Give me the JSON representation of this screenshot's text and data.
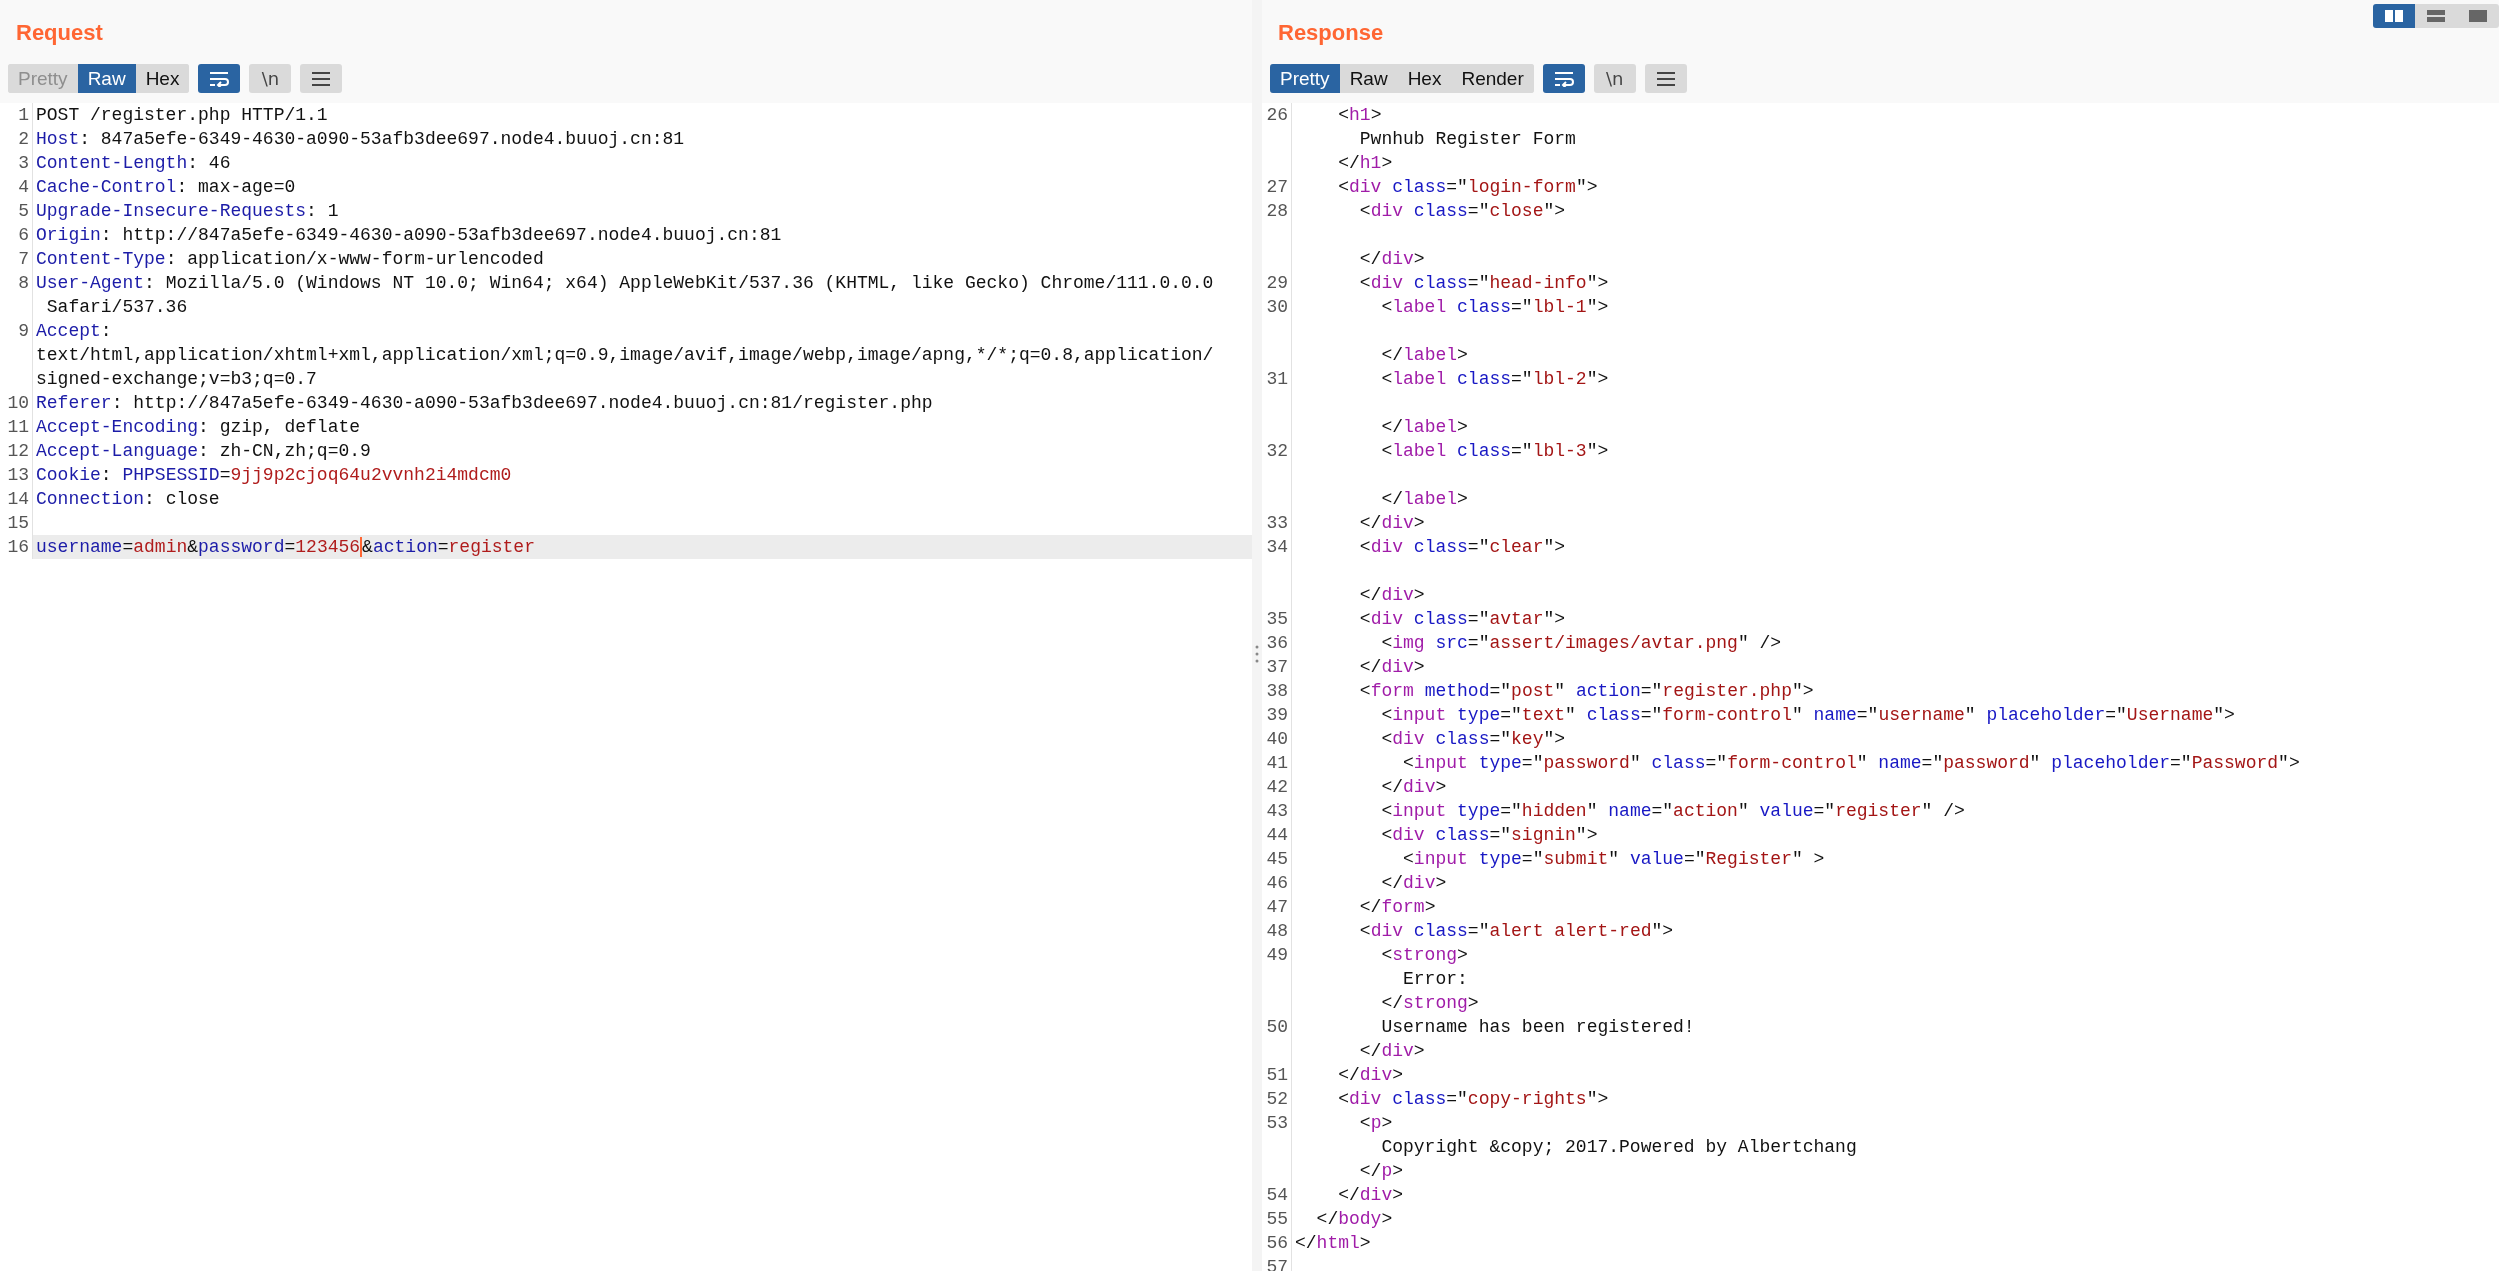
{
  "layout_modes": [
    {
      "kind": "columns",
      "selected": true
    },
    {
      "kind": "rows",
      "selected": false
    },
    {
      "kind": "single",
      "selected": false
    }
  ],
  "request": {
    "title": "Request",
    "tabs": [
      {
        "label": "Pretty",
        "selected": false,
        "disabled": true
      },
      {
        "label": "Raw",
        "selected": true,
        "disabled": false
      },
      {
        "label": "Hex",
        "selected": false,
        "disabled": false
      }
    ],
    "tools": [
      {
        "kind": "wrap",
        "active": true
      },
      {
        "kind": "newline",
        "label": "\\n",
        "active": false
      },
      {
        "kind": "menu",
        "active": false
      }
    ],
    "rows": [
      {
        "number": "1",
        "highlighted": false,
        "tokens": [
          {
            "kind": "plain",
            "text": "POST /register.php HTTP/1.1"
          }
        ]
      },
      {
        "number": "2",
        "highlighted": false,
        "tokens": [
          {
            "kind": "header",
            "text": "Host"
          },
          {
            "kind": "plain",
            "text": ": 847a5efe-6349-4630-a090-53afb3dee697.node4.buuoj.cn:81"
          }
        ]
      },
      {
        "number": "3",
        "highlighted": false,
        "tokens": [
          {
            "kind": "header",
            "text": "Content-Length"
          },
          {
            "kind": "plain",
            "text": ": 46"
          }
        ]
      },
      {
        "number": "4",
        "highlighted": false,
        "tokens": [
          {
            "kind": "header",
            "text": "Cache-Control"
          },
          {
            "kind": "plain",
            "text": ": max-age=0"
          }
        ]
      },
      {
        "number": "5",
        "highlighted": false,
        "tokens": [
          {
            "kind": "header",
            "text": "Upgrade-Insecure-Requests"
          },
          {
            "kind": "plain",
            "text": ": 1"
          }
        ]
      },
      {
        "number": "6",
        "highlighted": false,
        "tokens": [
          {
            "kind": "header",
            "text": "Origin"
          },
          {
            "kind": "plain",
            "text": ": http://847a5efe-6349-4630-a090-53afb3dee697.node4.buuoj.cn:81"
          }
        ]
      },
      {
        "number": "7",
        "highlighted": false,
        "tokens": [
          {
            "kind": "header",
            "text": "Content-Type"
          },
          {
            "kind": "plain",
            "text": ": application/x-www-form-urlencoded"
          }
        ]
      },
      {
        "number": "8",
        "highlighted": false,
        "tokens": [
          {
            "kind": "header",
            "text": "User-Agent"
          },
          {
            "kind": "plain",
            "text": ": Mozilla/5.0 (Windows NT 10.0; Win64; x64) AppleWebKit/537.36 (KHTML, like Gecko) Chrome/111.0.0.0"
          }
        ]
      },
      {
        "highlighted": false,
        "tokens": [
          {
            "kind": "plain",
            "text": " Safari/537.36"
          }
        ]
      },
      {
        "number": "9",
        "highlighted": false,
        "tokens": [
          {
            "kind": "header",
            "text": "Accept"
          },
          {
            "kind": "plain",
            "text": ":"
          }
        ]
      },
      {
        "highlighted": false,
        "tokens": [
          {
            "kind": "plain",
            "text": "text/html,application/xhtml+xml,application/xml;q=0.9,image/avif,image/webp,image/apng,*/*;q=0.8,application/"
          }
        ]
      },
      {
        "highlighted": false,
        "tokens": [
          {
            "kind": "plain",
            "text": "signed-exchange;v=b3;q=0.7"
          }
        ]
      },
      {
        "number": "10",
        "highlighted": false,
        "tokens": [
          {
            "kind": "header",
            "text": "Referer"
          },
          {
            "kind": "plain",
            "text": ": http://847a5efe-6349-4630-a090-53afb3dee697.node4.buuoj.cn:81/register.php"
          }
        ]
      },
      {
        "number": "11",
        "highlighted": false,
        "tokens": [
          {
            "kind": "header",
            "text": "Accept-Encoding"
          },
          {
            "kind": "plain",
            "text": ": gzip, deflate"
          }
        ]
      },
      {
        "number": "12",
        "highlighted": false,
        "tokens": [
          {
            "kind": "header",
            "text": "Accept-Language"
          },
          {
            "kind": "plain",
            "text": ": zh-CN,zh;q=0.9"
          }
        ]
      },
      {
        "number": "13",
        "highlighted": false,
        "tokens": [
          {
            "kind": "header",
            "text": "Cookie"
          },
          {
            "kind": "plain",
            "text": ": "
          },
          {
            "kind": "header",
            "text": "PHPSESSID"
          },
          {
            "kind": "plain",
            "text": "="
          },
          {
            "kind": "value",
            "text": "9jj9p2cjoq64u2vvnh2i4mdcm0"
          }
        ]
      },
      {
        "number": "14",
        "highlighted": false,
        "tokens": [
          {
            "kind": "header",
            "text": "Connection"
          },
          {
            "kind": "plain",
            "text": ": close"
          }
        ]
      },
      {
        "number": "15",
        "highlighted": false
      },
      {
        "number": "16",
        "highlighted": true,
        "tokens": [
          {
            "kind": "header",
            "text": "username"
          },
          {
            "kind": "plain",
            "text": "="
          },
          {
            "kind": "value",
            "text": "admin"
          },
          {
            "kind": "plain",
            "text": "&"
          },
          {
            "kind": "header",
            "text": "password"
          },
          {
            "kind": "plain",
            "text": "="
          },
          {
            "kind": "value",
            "text": "123456",
            "caret": true
          },
          {
            "kind": "plain",
            "text": "&"
          },
          {
            "kind": "header",
            "text": "action"
          },
          {
            "kind": "plain",
            "text": "="
          },
          {
            "kind": "value",
            "text": "register"
          }
        ]
      }
    ]
  },
  "response": {
    "title": "Response",
    "tabs": [
      {
        "label": "Pretty",
        "selected": true,
        "disabled": false
      },
      {
        "label": "Raw",
        "selected": false,
        "disabled": false
      },
      {
        "label": "Hex",
        "selected": false,
        "disabled": false
      },
      {
        "label": "Render",
        "selected": false,
        "disabled": false
      }
    ],
    "tools": [
      {
        "kind": "wrap",
        "active": true
      },
      {
        "kind": "newline",
        "label": "\\n",
        "active": false
      },
      {
        "kind": "menu",
        "active": false
      }
    ],
    "rows": [
      {
        "number": "26",
        "tokens": [
          {
            "kind": "plain",
            "text": "    <"
          },
          {
            "kind": "tag",
            "text": "h1"
          },
          {
            "kind": "plain",
            "text": ">"
          }
        ]
      },
      {
        "tokens": [
          {
            "kind": "plain",
            "text": "      Pwnhub Register Form"
          }
        ]
      },
      {
        "tokens": [
          {
            "kind": "plain",
            "text": "    </"
          },
          {
            "kind": "tag",
            "text": "h1"
          },
          {
            "kind": "plain",
            "text": ">"
          }
        ]
      },
      {
        "number": "27",
        "tokens": [
          {
            "kind": "plain",
            "text": "    <"
          },
          {
            "kind": "tag",
            "text": "div"
          },
          {
            "kind": "attr",
            "text": " class"
          },
          {
            "kind": "plain",
            "text": "=\""
          },
          {
            "kind": "string",
            "text": "login-form"
          },
          {
            "kind": "plain",
            "text": "\">"
          }
        ]
      },
      {
        "number": "28",
        "tokens": [
          {
            "kind": "plain",
            "text": "      <"
          },
          {
            "kind": "tag",
            "text": "div"
          },
          {
            "kind": "attr",
            "text": " class"
          },
          {
            "kind": "plain",
            "text": "=\""
          },
          {
            "kind": "string",
            "text": "close"
          },
          {
            "kind": "plain",
            "text": "\">"
          }
        ]
      },
      {},
      {
        "tokens": [
          {
            "kind": "plain",
            "text": "      </"
          },
          {
            "kind": "tag",
            "text": "div"
          },
          {
            "kind": "plain",
            "text": ">"
          }
        ]
      },
      {
        "number": "29",
        "tokens": [
          {
            "kind": "plain",
            "text": "      <"
          },
          {
            "kind": "tag",
            "text": "div"
          },
          {
            "kind": "attr",
            "text": " class"
          },
          {
            "kind": "plain",
            "text": "=\""
          },
          {
            "kind": "string",
            "text": "head-info"
          },
          {
            "kind": "plain",
            "text": "\">"
          }
        ]
      },
      {
        "number": "30",
        "tokens": [
          {
            "kind": "plain",
            "text": "        <"
          },
          {
            "kind": "tag",
            "text": "label"
          },
          {
            "kind": "attr",
            "text": " class"
          },
          {
            "kind": "plain",
            "text": "=\""
          },
          {
            "kind": "string",
            "text": "lbl-1"
          },
          {
            "kind": "plain",
            "text": "\">"
          }
        ]
      },
      {},
      {
        "tokens": [
          {
            "kind": "plain",
            "text": "        </"
          },
          {
            "kind": "tag",
            "text": "label"
          },
          {
            "kind": "plain",
            "text": ">"
          }
        ]
      },
      {
        "number": "31",
        "tokens": [
          {
            "kind": "plain",
            "text": "        <"
          },
          {
            "kind": "tag",
            "text": "label"
          },
          {
            "kind": "attr",
            "text": " class"
          },
          {
            "kind": "plain",
            "text": "=\""
          },
          {
            "kind": "string",
            "text": "lbl-2"
          },
          {
            "kind": "plain",
            "text": "\">"
          }
        ]
      },
      {},
      {
        "tokens": [
          {
            "kind": "plain",
            "text": "        </"
          },
          {
            "kind": "tag",
            "text": "label"
          },
          {
            "kind": "plain",
            "text": ">"
          }
        ]
      },
      {
        "number": "32",
        "tokens": [
          {
            "kind": "plain",
            "text": "        <"
          },
          {
            "kind": "tag",
            "text": "label"
          },
          {
            "kind": "attr",
            "text": " class"
          },
          {
            "kind": "plain",
            "text": "=\""
          },
          {
            "kind": "string",
            "text": "lbl-3"
          },
          {
            "kind": "plain",
            "text": "\">"
          }
        ]
      },
      {},
      {
        "tokens": [
          {
            "kind": "plain",
            "text": "        </"
          },
          {
            "kind": "tag",
            "text": "label"
          },
          {
            "kind": "plain",
            "text": ">"
          }
        ]
      },
      {
        "number": "33",
        "tokens": [
          {
            "kind": "plain",
            "text": "      </"
          },
          {
            "kind": "tag",
            "text": "div"
          },
          {
            "kind": "plain",
            "text": ">"
          }
        ]
      },
      {
        "number": "34",
        "tokens": [
          {
            "kind": "plain",
            "text": "      <"
          },
          {
            "kind": "tag",
            "text": "div"
          },
          {
            "kind": "attr",
            "text": " class"
          },
          {
            "kind": "plain",
            "text": "=\""
          },
          {
            "kind": "string",
            "text": "clear"
          },
          {
            "kind": "plain",
            "text": "\">"
          }
        ]
      },
      {},
      {
        "tokens": [
          {
            "kind": "plain",
            "text": "      </"
          },
          {
            "kind": "tag",
            "text": "div"
          },
          {
            "kind": "plain",
            "text": ">"
          }
        ]
      },
      {
        "number": "35",
        "tokens": [
          {
            "kind": "plain",
            "text": "      <"
          },
          {
            "kind": "tag",
            "text": "div"
          },
          {
            "kind": "attr",
            "text": " class"
          },
          {
            "kind": "plain",
            "text": "=\""
          },
          {
            "kind": "string",
            "text": "avtar"
          },
          {
            "kind": "plain",
            "text": "\">"
          }
        ]
      },
      {
        "number": "36",
        "tokens": [
          {
            "kind": "plain",
            "text": "        <"
          },
          {
            "kind": "tag",
            "text": "img"
          },
          {
            "kind": "attr",
            "text": " src"
          },
          {
            "kind": "plain",
            "text": "=\""
          },
          {
            "kind": "string",
            "text": "assert/images/avtar.png"
          },
          {
            "kind": "plain",
            "text": "\" />"
          }
        ]
      },
      {
        "number": "37",
        "tokens": [
          {
            "kind": "plain",
            "text": "      </"
          },
          {
            "kind": "tag",
            "text": "div"
          },
          {
            "kind": "plain",
            "text": ">"
          }
        ]
      },
      {
        "number": "38",
        "tokens": [
          {
            "kind": "plain",
            "text": "      <"
          },
          {
            "kind": "tag",
            "text": "form"
          },
          {
            "kind": "attr",
            "text": " method"
          },
          {
            "kind": "plain",
            "text": "=\""
          },
          {
            "kind": "string",
            "text": "post"
          },
          {
            "kind": "plain",
            "text": "\" "
          },
          {
            "kind": "attr",
            "text": "action"
          },
          {
            "kind": "plain",
            "text": "=\""
          },
          {
            "kind": "string",
            "text": "register.php"
          },
          {
            "kind": "plain",
            "text": "\">"
          }
        ]
      },
      {
        "number": "39",
        "tokens": [
          {
            "kind": "plain",
            "text": "        <"
          },
          {
            "kind": "tag",
            "text": "input"
          },
          {
            "kind": "attr",
            "text": " type"
          },
          {
            "kind": "plain",
            "text": "=\""
          },
          {
            "kind": "string",
            "text": "text"
          },
          {
            "kind": "plain",
            "text": "\" "
          },
          {
            "kind": "attr",
            "text": "class"
          },
          {
            "kind": "plain",
            "text": "=\""
          },
          {
            "kind": "string",
            "text": "form-control"
          },
          {
            "kind": "plain",
            "text": "\" "
          },
          {
            "kind": "attr",
            "text": "name"
          },
          {
            "kind": "plain",
            "text": "=\""
          },
          {
            "kind": "string",
            "text": "username"
          },
          {
            "kind": "plain",
            "text": "\" "
          },
          {
            "kind": "attr",
            "text": "placeholder"
          },
          {
            "kind": "plain",
            "text": "=\""
          },
          {
            "kind": "string",
            "text": "Username"
          },
          {
            "kind": "plain",
            "text": "\">"
          }
        ]
      },
      {
        "number": "40",
        "tokens": [
          {
            "kind": "plain",
            "text": "        <"
          },
          {
            "kind": "tag",
            "text": "div"
          },
          {
            "kind": "attr",
            "text": " class"
          },
          {
            "kind": "plain",
            "text": "=\""
          },
          {
            "kind": "string",
            "text": "key"
          },
          {
            "kind": "plain",
            "text": "\">"
          }
        ]
      },
      {
        "number": "41",
        "tokens": [
          {
            "kind": "plain",
            "text": "          <"
          },
          {
            "kind": "tag",
            "text": "input"
          },
          {
            "kind": "attr",
            "text": " type"
          },
          {
            "kind": "plain",
            "text": "=\""
          },
          {
            "kind": "string",
            "text": "password"
          },
          {
            "kind": "plain",
            "text": "\" "
          },
          {
            "kind": "attr",
            "text": "class"
          },
          {
            "kind": "plain",
            "text": "=\""
          },
          {
            "kind": "string",
            "text": "form-control"
          },
          {
            "kind": "plain",
            "text": "\" "
          },
          {
            "kind": "attr",
            "text": "name"
          },
          {
            "kind": "plain",
            "text": "=\""
          },
          {
            "kind": "string",
            "text": "password"
          },
          {
            "kind": "plain",
            "text": "\" "
          },
          {
            "kind": "attr",
            "text": "placeholder"
          },
          {
            "kind": "plain",
            "text": "=\""
          },
          {
            "kind": "string",
            "text": "Password"
          },
          {
            "kind": "plain",
            "text": "\">"
          }
        ]
      },
      {
        "number": "42",
        "tokens": [
          {
            "kind": "plain",
            "text": "        </"
          },
          {
            "kind": "tag",
            "text": "div"
          },
          {
            "kind": "plain",
            "text": ">"
          }
        ]
      },
      {
        "number": "43",
        "tokens": [
          {
            "kind": "plain",
            "text": "        <"
          },
          {
            "kind": "tag",
            "text": "input"
          },
          {
            "kind": "attr",
            "text": " type"
          },
          {
            "kind": "plain",
            "text": "=\""
          },
          {
            "kind": "string",
            "text": "hidden"
          },
          {
            "kind": "plain",
            "text": "\" "
          },
          {
            "kind": "attr",
            "text": "name"
          },
          {
            "kind": "plain",
            "text": "=\""
          },
          {
            "kind": "string",
            "text": "action"
          },
          {
            "kind": "plain",
            "text": "\" "
          },
          {
            "kind": "attr",
            "text": "value"
          },
          {
            "kind": "plain",
            "text": "=\""
          },
          {
            "kind": "string",
            "text": "register"
          },
          {
            "kind": "plain",
            "text": "\" />"
          }
        ]
      },
      {
        "number": "44",
        "tokens": [
          {
            "kind": "plain",
            "text": "        <"
          },
          {
            "kind": "tag",
            "text": "div"
          },
          {
            "kind": "attr",
            "text": " class"
          },
          {
            "kind": "plain",
            "text": "=\""
          },
          {
            "kind": "string",
            "text": "signin"
          },
          {
            "kind": "plain",
            "text": "\">"
          }
        ]
      },
      {
        "number": "45",
        "tokens": [
          {
            "kind": "plain",
            "text": "          <"
          },
          {
            "kind": "tag",
            "text": "input"
          },
          {
            "kind": "attr",
            "text": " type"
          },
          {
            "kind": "plain",
            "text": "=\""
          },
          {
            "kind": "string",
            "text": "submit"
          },
          {
            "kind": "plain",
            "text": "\" "
          },
          {
            "kind": "attr",
            "text": "value"
          },
          {
            "kind": "plain",
            "text": "=\""
          },
          {
            "kind": "string",
            "text": "Register"
          },
          {
            "kind": "plain",
            "text": "\" >"
          }
        ]
      },
      {
        "number": "46",
        "tokens": [
          {
            "kind": "plain",
            "text": "        </"
          },
          {
            "kind": "tag",
            "text": "div"
          },
          {
            "kind": "plain",
            "text": ">"
          }
        ]
      },
      {
        "number": "47",
        "tokens": [
          {
            "kind": "plain",
            "text": "      </"
          },
          {
            "kind": "tag",
            "text": "form"
          },
          {
            "kind": "plain",
            "text": ">"
          }
        ]
      },
      {
        "number": "48",
        "tokens": [
          {
            "kind": "plain",
            "text": "      <"
          },
          {
            "kind": "tag",
            "text": "div"
          },
          {
            "kind": "attr",
            "text": " class"
          },
          {
            "kind": "plain",
            "text": "=\""
          },
          {
            "kind": "string",
            "text": "alert alert-red"
          },
          {
            "kind": "plain",
            "text": "\">"
          }
        ]
      },
      {
        "number": "49",
        "tokens": [
          {
            "kind": "plain",
            "text": "        <"
          },
          {
            "kind": "tag",
            "text": "strong"
          },
          {
            "kind": "plain",
            "text": ">"
          }
        ]
      },
      {
        "tokens": [
          {
            "kind": "plain",
            "text": "          Error:"
          }
        ]
      },
      {
        "tokens": [
          {
            "kind": "plain",
            "text": "        </"
          },
          {
            "kind": "tag",
            "text": "strong"
          },
          {
            "kind": "plain",
            "text": ">"
          }
        ]
      },
      {
        "number": "50",
        "tokens": [
          {
            "kind": "plain",
            "text": "        Username has been registered!"
          }
        ]
      },
      {
        "tokens": [
          {
            "kind": "plain",
            "text": "      </"
          },
          {
            "kind": "tag",
            "text": "div"
          },
          {
            "kind": "plain",
            "text": ">"
          }
        ]
      },
      {
        "number": "51",
        "tokens": [
          {
            "kind": "plain",
            "text": "    </"
          },
          {
            "kind": "tag",
            "text": "div"
          },
          {
            "kind": "plain",
            "text": ">"
          }
        ]
      },
      {
        "number": "52",
        "tokens": [
          {
            "kind": "plain",
            "text": "    <"
          },
          {
            "kind": "tag",
            "text": "div"
          },
          {
            "kind": "attr",
            "text": " class"
          },
          {
            "kind": "plain",
            "text": "=\""
          },
          {
            "kind": "string",
            "text": "copy-rights"
          },
          {
            "kind": "plain",
            "text": "\">"
          }
        ]
      },
      {
        "number": "53",
        "tokens": [
          {
            "kind": "plain",
            "text": "      <"
          },
          {
            "kind": "tag",
            "text": "p"
          },
          {
            "kind": "plain",
            "text": ">"
          }
        ]
      },
      {
        "tokens": [
          {
            "kind": "plain",
            "text": "        Copyright &copy; 2017.Powered by Albertchang"
          }
        ]
      },
      {
        "tokens": [
          {
            "kind": "plain",
            "text": "      </"
          },
          {
            "kind": "tag",
            "text": "p"
          },
          {
            "kind": "plain",
            "text": ">"
          }
        ]
      },
      {
        "number": "54",
        "tokens": [
          {
            "kind": "plain",
            "text": "    </"
          },
          {
            "kind": "tag",
            "text": "div"
          },
          {
            "kind": "plain",
            "text": ">"
          }
        ]
      },
      {
        "number": "55",
        "tokens": [
          {
            "kind": "plain",
            "text": "  </"
          },
          {
            "kind": "tag",
            "text": "body"
          },
          {
            "kind": "plain",
            "text": ">"
          }
        ]
      },
      {
        "number": "56",
        "tokens": [
          {
            "kind": "plain",
            "text": "</"
          },
          {
            "kind": "tag",
            "text": "html"
          },
          {
            "kind": "plain",
            "text": ">"
          }
        ]
      },
      {
        "number": "57"
      }
    ]
  }
}
